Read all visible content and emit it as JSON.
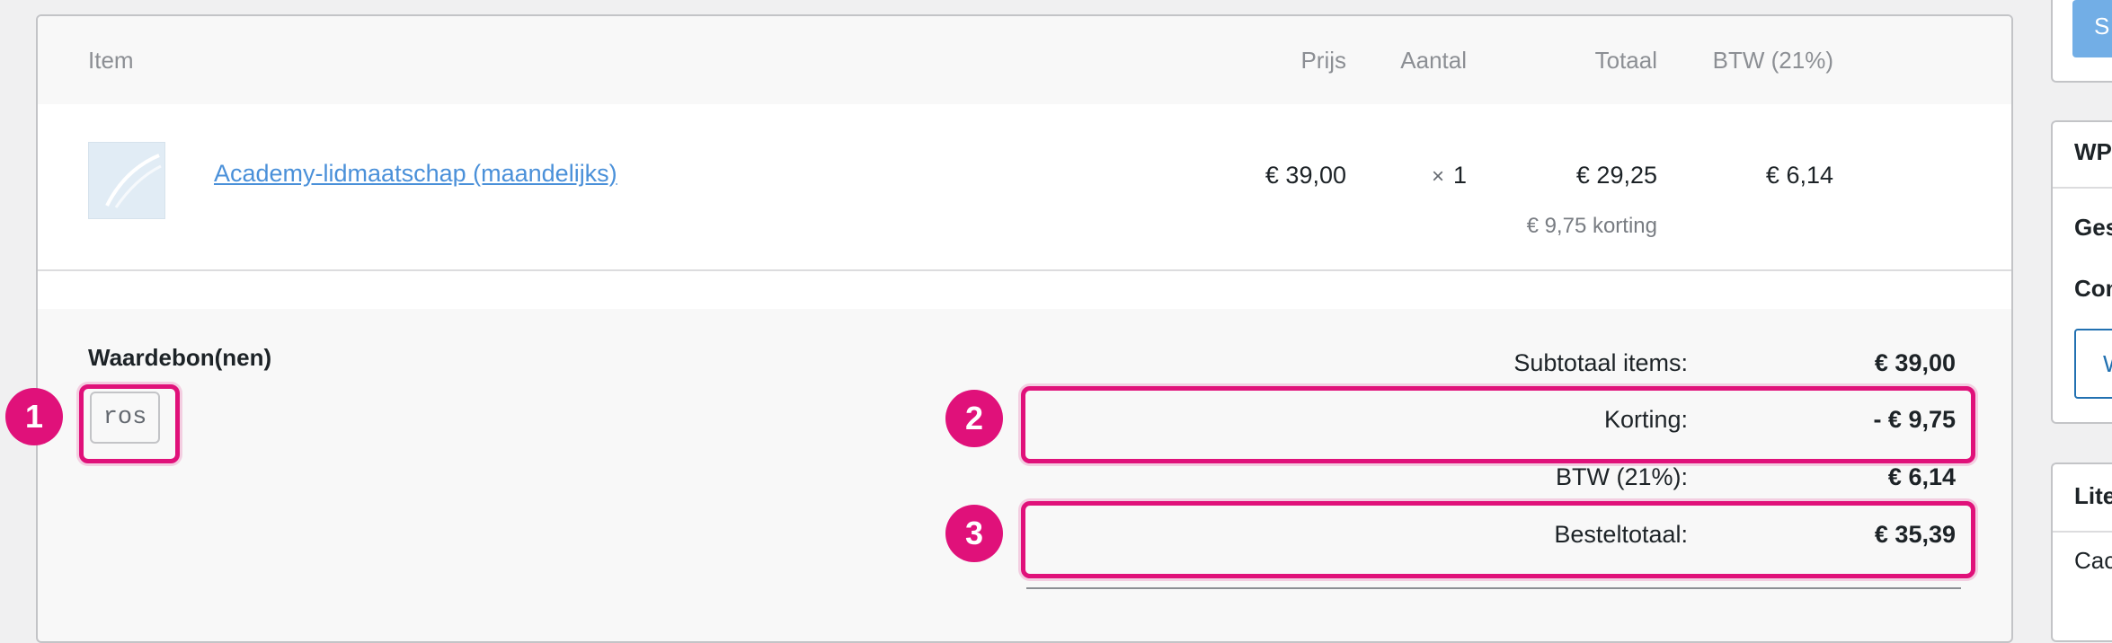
{
  "table": {
    "headers": {
      "item": "Item",
      "prijs": "Prijs",
      "aantal": "Aantal",
      "totaal": "Totaal",
      "btw": "BTW (21%)"
    },
    "rows": [
      {
        "product": "Academy-lidmaatschap (maandelijks)",
        "prijs": "€ 39,00",
        "aantal_symbol": "×",
        "aantal": "1",
        "totaal": "€ 29,25",
        "korting_note": "€ 9,75 korting",
        "btw": "€ 6,14"
      }
    ]
  },
  "coupons": {
    "title": "Waardebon(nen)",
    "items": [
      "ros"
    ]
  },
  "totals": {
    "subtotal_label": "Subtotaal items:",
    "subtotal_value": "€ 39,00",
    "discount_label": "Korting:",
    "discount_value": "- € 9,75",
    "tax_label": "BTW (21%):",
    "tax_value": "€ 6,14",
    "order_total_label": "Besteltotaal:",
    "order_total_value": "€ 35,39"
  },
  "annotations": {
    "badge_1": "1",
    "badge_2": "2",
    "badge_3": "3",
    "color": "#e0117a"
  },
  "sidebar": {
    "top_button_label": "S",
    "card_mid_title": "WP",
    "card_mid_line1": "Ges",
    "card_mid_line2": "Con",
    "card_mid_button": "W",
    "card_bot_title": "Lite",
    "card_bot_line1": "Cac"
  }
}
